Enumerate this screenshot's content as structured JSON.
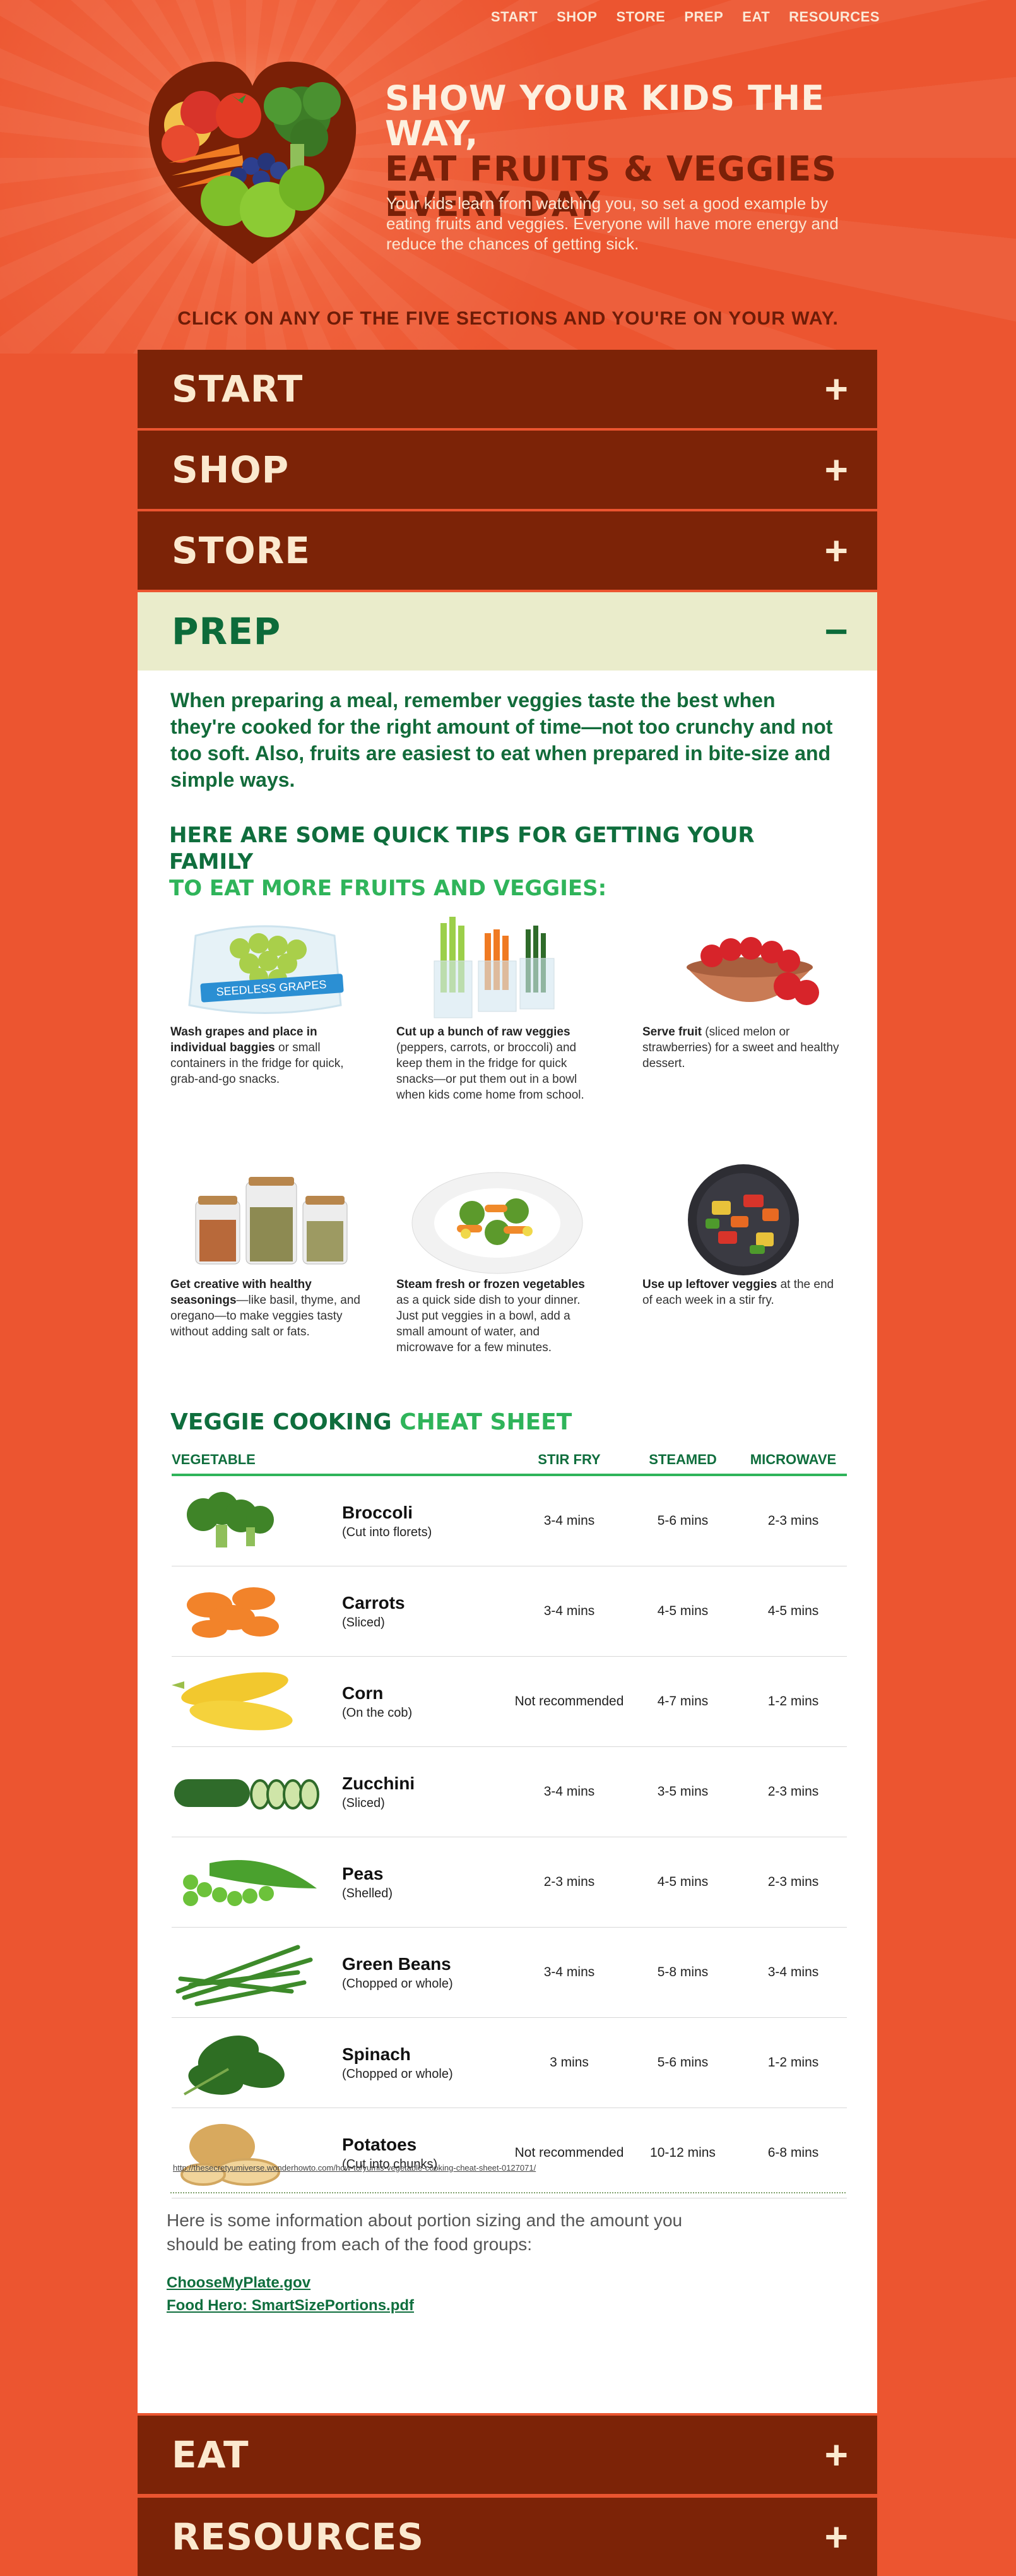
{
  "nav": [
    "START",
    "SHOP",
    "STORE",
    "PREP",
    "EAT",
    "RESOURCES"
  ],
  "hero": {
    "title_line1": "SHOW YOUR KIDS THE WAY,",
    "title_line2": "EAT FRUITS & VEGGIES",
    "title_line3": "EVERY DAY",
    "subtitle": "Your kids learn from watching you, so set a good example by eating fruits and veggies. Everyone will have more energy and reduce the chances of getting sick."
  },
  "cta": "CLICK ON ANY OF THE FIVE SECTIONS AND YOU'RE ON YOUR WAY.",
  "sections": [
    {
      "title": "START",
      "icon": "+"
    },
    {
      "title": "SHOP",
      "icon": "+"
    },
    {
      "title": "STORE",
      "icon": "+"
    },
    {
      "title": "PREP",
      "icon": "−"
    },
    {
      "title": "EAT",
      "icon": "+"
    },
    {
      "title": "RESOURCES",
      "icon": "+"
    }
  ],
  "prep": {
    "intro": "When preparing a meal, remember veggies taste the best when they're cooked for the right amount of time—not too crunchy and not too soft. Also, fruits are easiest to eat when prepared in bite-size and simple ways.",
    "tips_title_a": "HERE ARE SOME QUICK TIPS FOR GETTING YOUR FAMILY",
    "tips_title_b": "TO EAT MORE FRUITS AND VEGGIES:",
    "grapes_label": "SEEDLESS GRAPES",
    "tips": [
      {
        "bold": "Wash grapes and place in individual baggies",
        "text": " or small containers in the fridge for quick, grab-and-go snacks."
      },
      {
        "bold": "Cut up a bunch of raw veggies",
        "text": " (peppers, carrots, or broccoli) and keep them in the fridge for quick snacks—or put them out in a bowl when kids come home from school."
      },
      {
        "bold": "Serve fruit",
        "text": " (sliced melon or strawberries) for a sweet and healthy dessert."
      },
      {
        "bold": "Get creative with healthy seasonings",
        "text": "—like basil, thyme, and oregano—to make veggies tasty without adding salt or fats."
      },
      {
        "bold": "Steam fresh or frozen vegetables",
        "text": " as a quick side dish to your dinner. Just put veggies in a bowl, add a small amount of water, and microwave for a few minutes."
      },
      {
        "bold": "Use up leftover veggies",
        "text": " at the end of each week in a stir fry."
      }
    ],
    "cheat_title_a": "VEGGIE COOKING",
    "cheat_title_b": "CHEAT SHEET",
    "table_headers": [
      "VEGETABLE",
      "STIR FRY",
      "STEAMED",
      "MICROWAVE"
    ],
    "rows": [
      {
        "name": "Broccoli",
        "note": "(Cut into florets)",
        "stir": "3-4 mins",
        "steam": "5-6 mins",
        "micro": "2-3 mins"
      },
      {
        "name": "Carrots",
        "note": "(Sliced)",
        "stir": "3-4 mins",
        "steam": "4-5 mins",
        "micro": "4-5 mins"
      },
      {
        "name": "Corn",
        "note": "(On the cob)",
        "stir": "Not recommended",
        "steam": "4-7 mins",
        "micro": "1-2 mins"
      },
      {
        "name": "Zucchini",
        "note": "(Sliced)",
        "stir": "3-4 mins",
        "steam": "3-5 mins",
        "micro": "2-3 mins"
      },
      {
        "name": "Peas",
        "note": "(Shelled)",
        "stir": "2-3 mins",
        "steam": "4-5 mins",
        "micro": "2-3 mins"
      },
      {
        "name": "Green Beans",
        "note": "(Chopped or whole)",
        "stir": "3-4 mins",
        "steam": "5-8 mins",
        "micro": "3-4 mins"
      },
      {
        "name": "Spinach",
        "note": "(Chopped or whole)",
        "stir": "3 mins",
        "steam": "5-6 mins",
        "micro": "1-2 mins"
      },
      {
        "name": "Potatoes",
        "note": "(Cut into chunks)",
        "stir": "Not recommended",
        "steam": "10-12 mins",
        "micro": "6-8 mins"
      }
    ],
    "source": "http://thesecretyumiverse.wonderhowto.com/how-to/yumis-vegetable-cooking-cheat-sheet-0127071/",
    "portion_text": "Here is some information about portion sizing and the amount you should be eating from each of the food groups:",
    "link1": "ChooseMyPlate.gov",
    "link2": "Food Hero: SmartSizePortions.pdf"
  }
}
